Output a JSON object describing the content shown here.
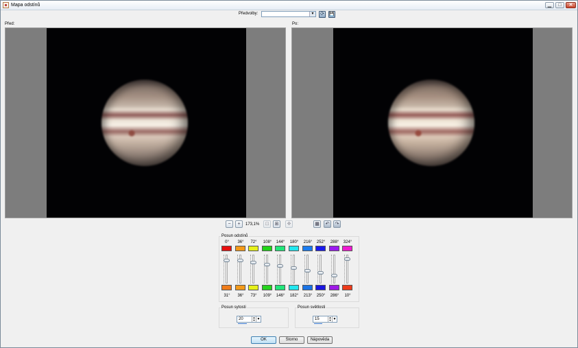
{
  "window": {
    "title": "Mapa odstínů",
    "min_glyph": "▁",
    "max_glyph": "□",
    "close_glyph": "✕"
  },
  "toolbar": {
    "presets_label": "Předvolby:",
    "presets_value": "",
    "refresh_glyph": "⟳",
    "save_glyph": "💾"
  },
  "panels": {
    "before_label": "Před:",
    "after_label": "Po:"
  },
  "zoom": {
    "value": "173,1%",
    "zoom_in_glyph": "+",
    "zoom_out_glyph": "−",
    "fit_glyph": "⊡",
    "actual_glyph": "⊞",
    "pan_glyph": "✥"
  },
  "view": {
    "layout_glyph": "▦",
    "undo_glyph": "↶",
    "redo_glyph": "↷"
  },
  "hue_shift": {
    "title": "Posun odstínů",
    "top_labels": [
      "0°",
      "36°",
      "72°",
      "108°",
      "144°",
      "180°",
      "216°",
      "252°",
      "288°",
      "324°"
    ],
    "top_colors": [
      "#e81010",
      "#f39a1a",
      "#e6f01a",
      "#22d418",
      "#22e67a",
      "#22e6ee",
      "#1a7cf0",
      "#1a1aee",
      "#9b1af0",
      "#ee1ad0"
    ],
    "bottom_labels": [
      "31°",
      "36°",
      "73°",
      "109°",
      "146°",
      "182°",
      "213°",
      "250°",
      "286°",
      "10°"
    ],
    "bottom_colors": [
      "#f07c1a",
      "#f39a1a",
      "#e6f01a",
      "#26d41e",
      "#22e67a",
      "#22e6ee",
      "#1a74e6",
      "#1a16e0",
      "#9e1ae6",
      "#ee3a1a"
    ],
    "slider_levels": [
      0.85,
      0.84,
      0.76,
      0.68,
      0.62,
      0.53,
      0.43,
      0.36,
      0.24,
      0.9
    ]
  },
  "saturation": {
    "title": "Posun sytosti",
    "value": "20",
    "level": 0.6
  },
  "lightness": {
    "title": "Posun světlosti",
    "value": "15",
    "level": 0.55
  },
  "buttons": {
    "ok": "OK",
    "reset": "Storno",
    "help": "Nápověda"
  }
}
